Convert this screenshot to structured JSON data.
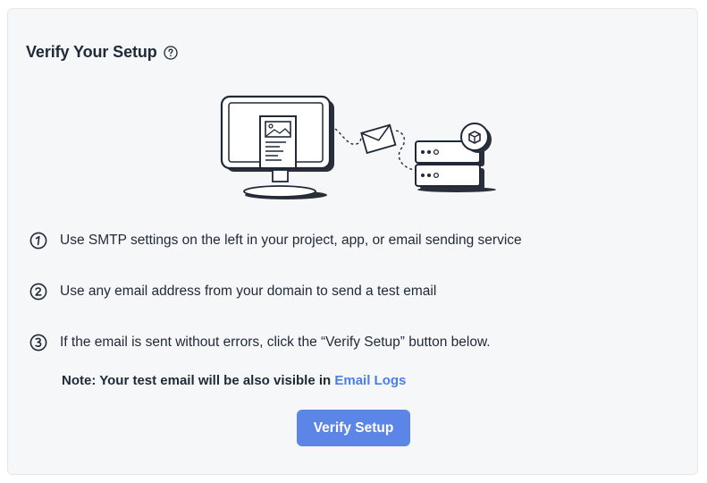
{
  "card": {
    "title": "Verify Your Setup"
  },
  "steps": [
    {
      "number": "1",
      "text": "Use SMTP settings on the left in your project, app, or email sending service"
    },
    {
      "number": "2",
      "text": "Use any email address from your domain to send a test email"
    },
    {
      "number": "3",
      "text": "If the email is sent without errors, click the “Verify Setup” button below."
    }
  ],
  "note": {
    "prefix": "Note: Your test email will be also visible in ",
    "link_label": "Email Logs"
  },
  "actions": {
    "verify_label": "Verify Setup"
  },
  "colors": {
    "accent": "#5b85e6",
    "link": "#4a7ee8",
    "card_background": "#f6f7f8",
    "text": "#1f2937"
  },
  "icons": {
    "help": "question-circle-icon",
    "illustration": "computer-email-server-illustration"
  }
}
